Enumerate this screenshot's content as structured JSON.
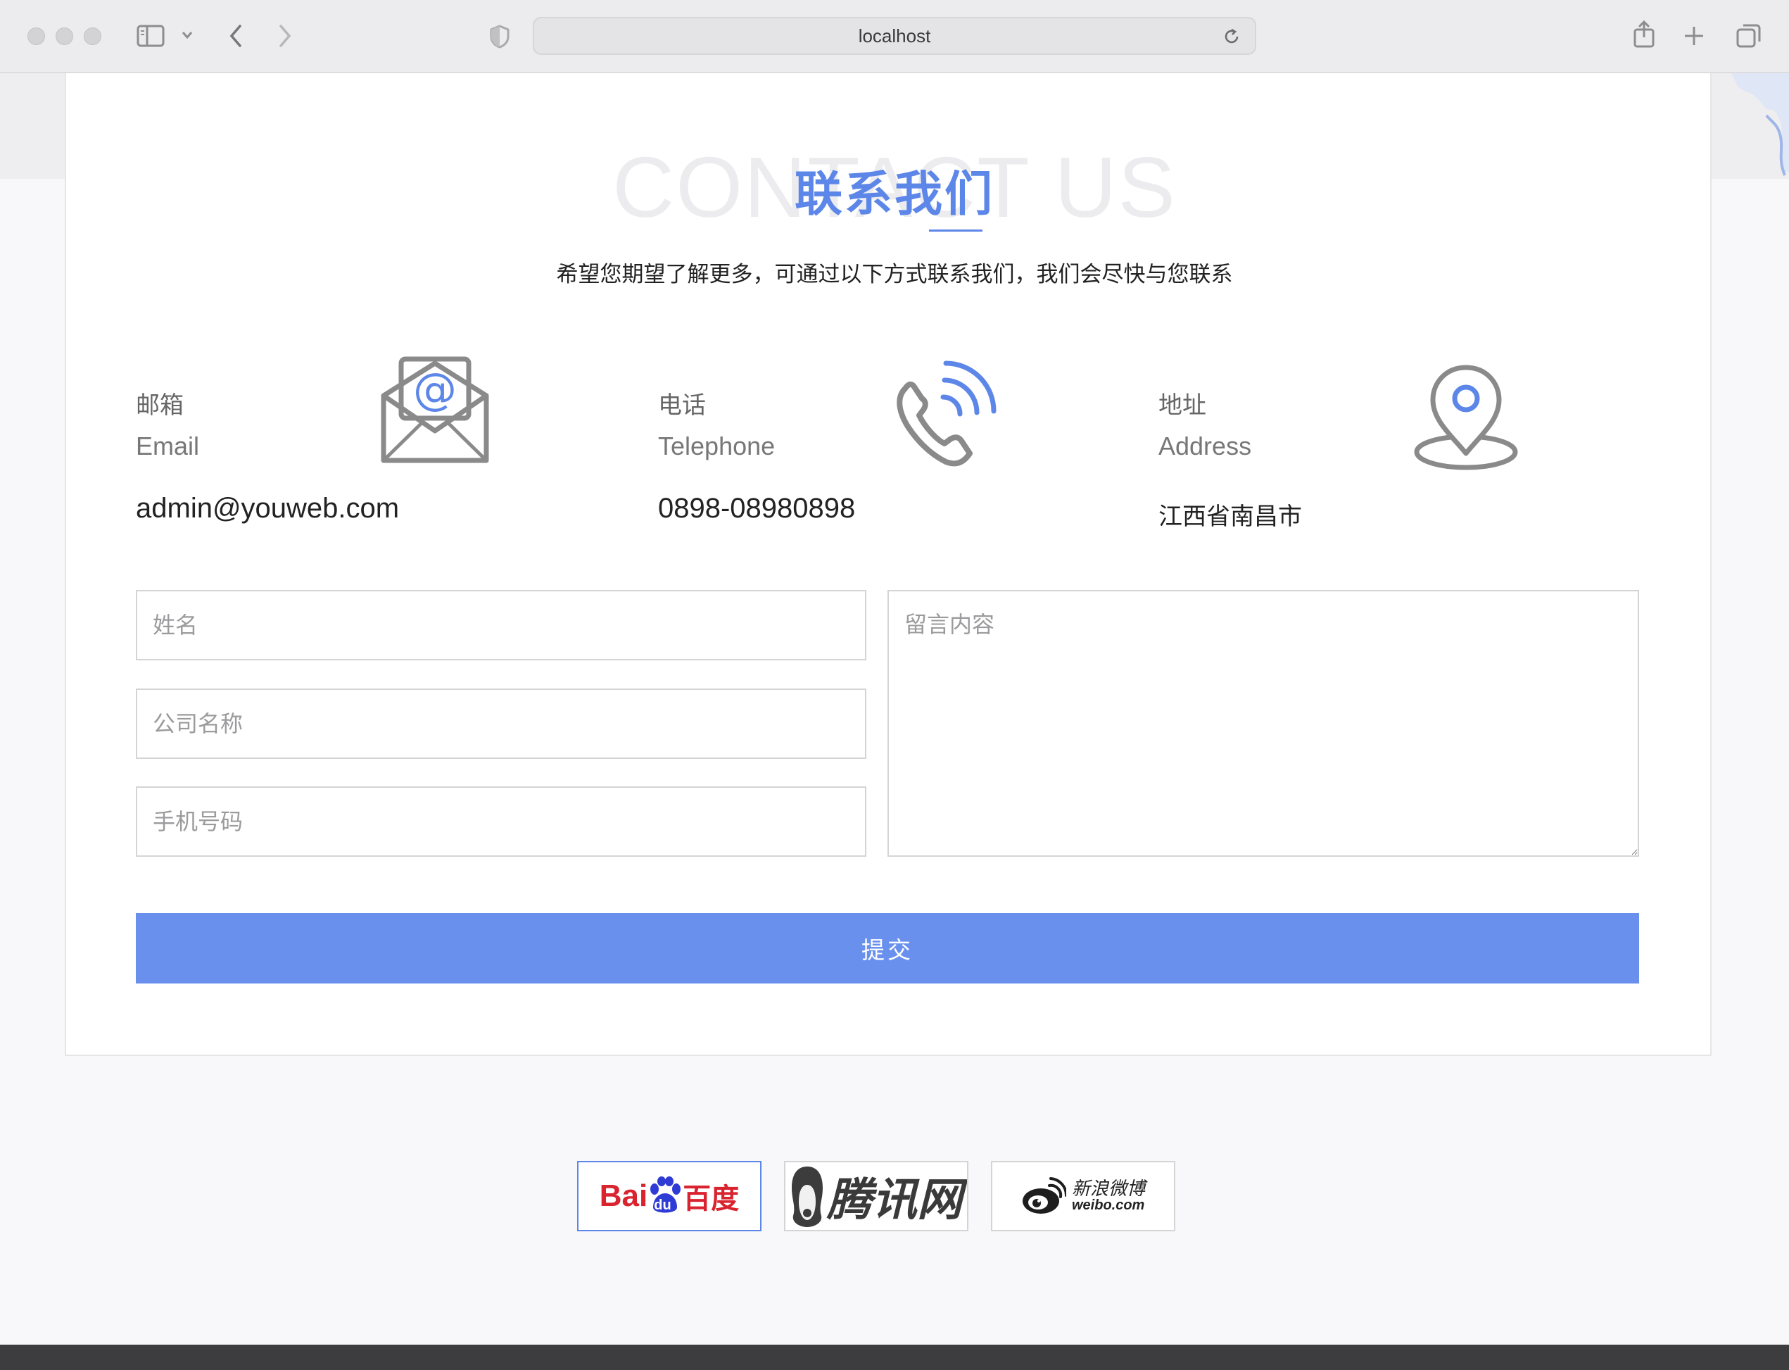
{
  "browser": {
    "url": "localhost"
  },
  "contact": {
    "watermark": "CONTACT US",
    "title": "联系我们",
    "subtitle": "希望您期望了解更多，可通过以下方式联系我们，我们会尽快与您联系"
  },
  "info": [
    {
      "label_zh": "邮箱",
      "label_en": "Email",
      "value": "admin@youweb.com",
      "icon": "email-envelope-icon"
    },
    {
      "label_zh": "电话",
      "label_en": "Telephone",
      "value": "0898-08980898",
      "icon": "phone-icon"
    },
    {
      "label_zh": "地址",
      "label_en": "Address",
      "value": "江西省南昌市",
      "icon": "location-pin-icon"
    }
  ],
  "form": {
    "name_placeholder": "姓名",
    "company_placeholder": "公司名称",
    "phone_placeholder": "手机号码",
    "message_placeholder": "留言内容",
    "submit_label": "提交"
  },
  "partners": [
    {
      "name": "Baidu",
      "logo_text_a": "Bai",
      "logo_text_b": "du",
      "logo_text_c": "百度"
    },
    {
      "name": "Tencent",
      "logo_text": "腾讯网"
    },
    {
      "name": "Weibo",
      "logo_text_a": "新浪微博",
      "logo_text_b": "weibo.com"
    }
  ],
  "colors": {
    "accent": "#5c86e8",
    "button": "#6a90ee",
    "icon_gray": "#8a8a8a"
  }
}
